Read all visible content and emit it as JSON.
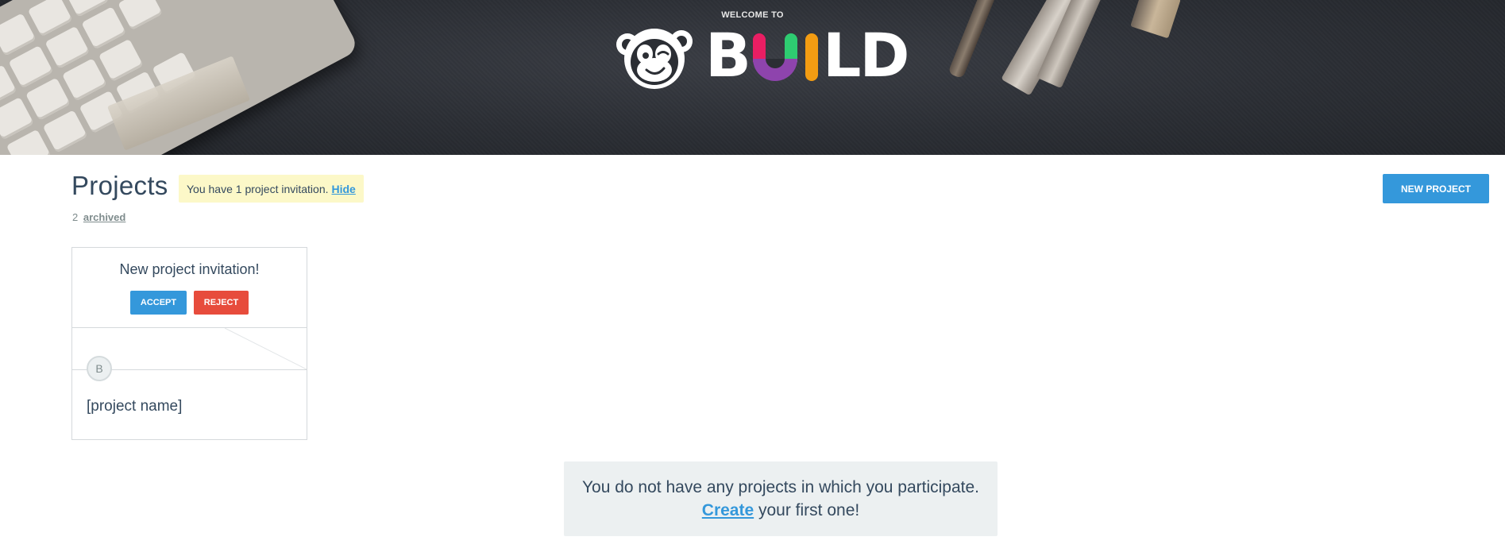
{
  "header": {
    "welcome_text": "WELCOME TO",
    "logo_text": "BUILD",
    "logo_letters": [
      "B",
      "U",
      "I",
      "L",
      "D"
    ],
    "logo_colors": {
      "u_left": "#e91e63",
      "u_bottom": "#8e44ad",
      "u_right": "#2ecc71",
      "i": "#f39c12",
      "white": "#ffffff"
    }
  },
  "page": {
    "title": "Projects",
    "invitation_notice": "You have 1 project invitation.",
    "invitation_hide": "Hide",
    "archived_count": "2",
    "archived_label": "archived",
    "new_project_button": "NEW PROJECT"
  },
  "invitation_card": {
    "title": "New project invitation!",
    "accept_label": "ACCEPT",
    "reject_label": "REJECT",
    "avatar_initial": "B",
    "project_name": "[project name]"
  },
  "empty_state": {
    "line1": "You do not have any projects in which you participate.",
    "create_link": "Create",
    "line2_rest": " your first one!"
  },
  "colors": {
    "primary": "#3498db",
    "danger": "#e74c3c",
    "text": "#34495e",
    "notice_bg": "#fcf8c8",
    "empty_bg": "#ecf0f1"
  }
}
